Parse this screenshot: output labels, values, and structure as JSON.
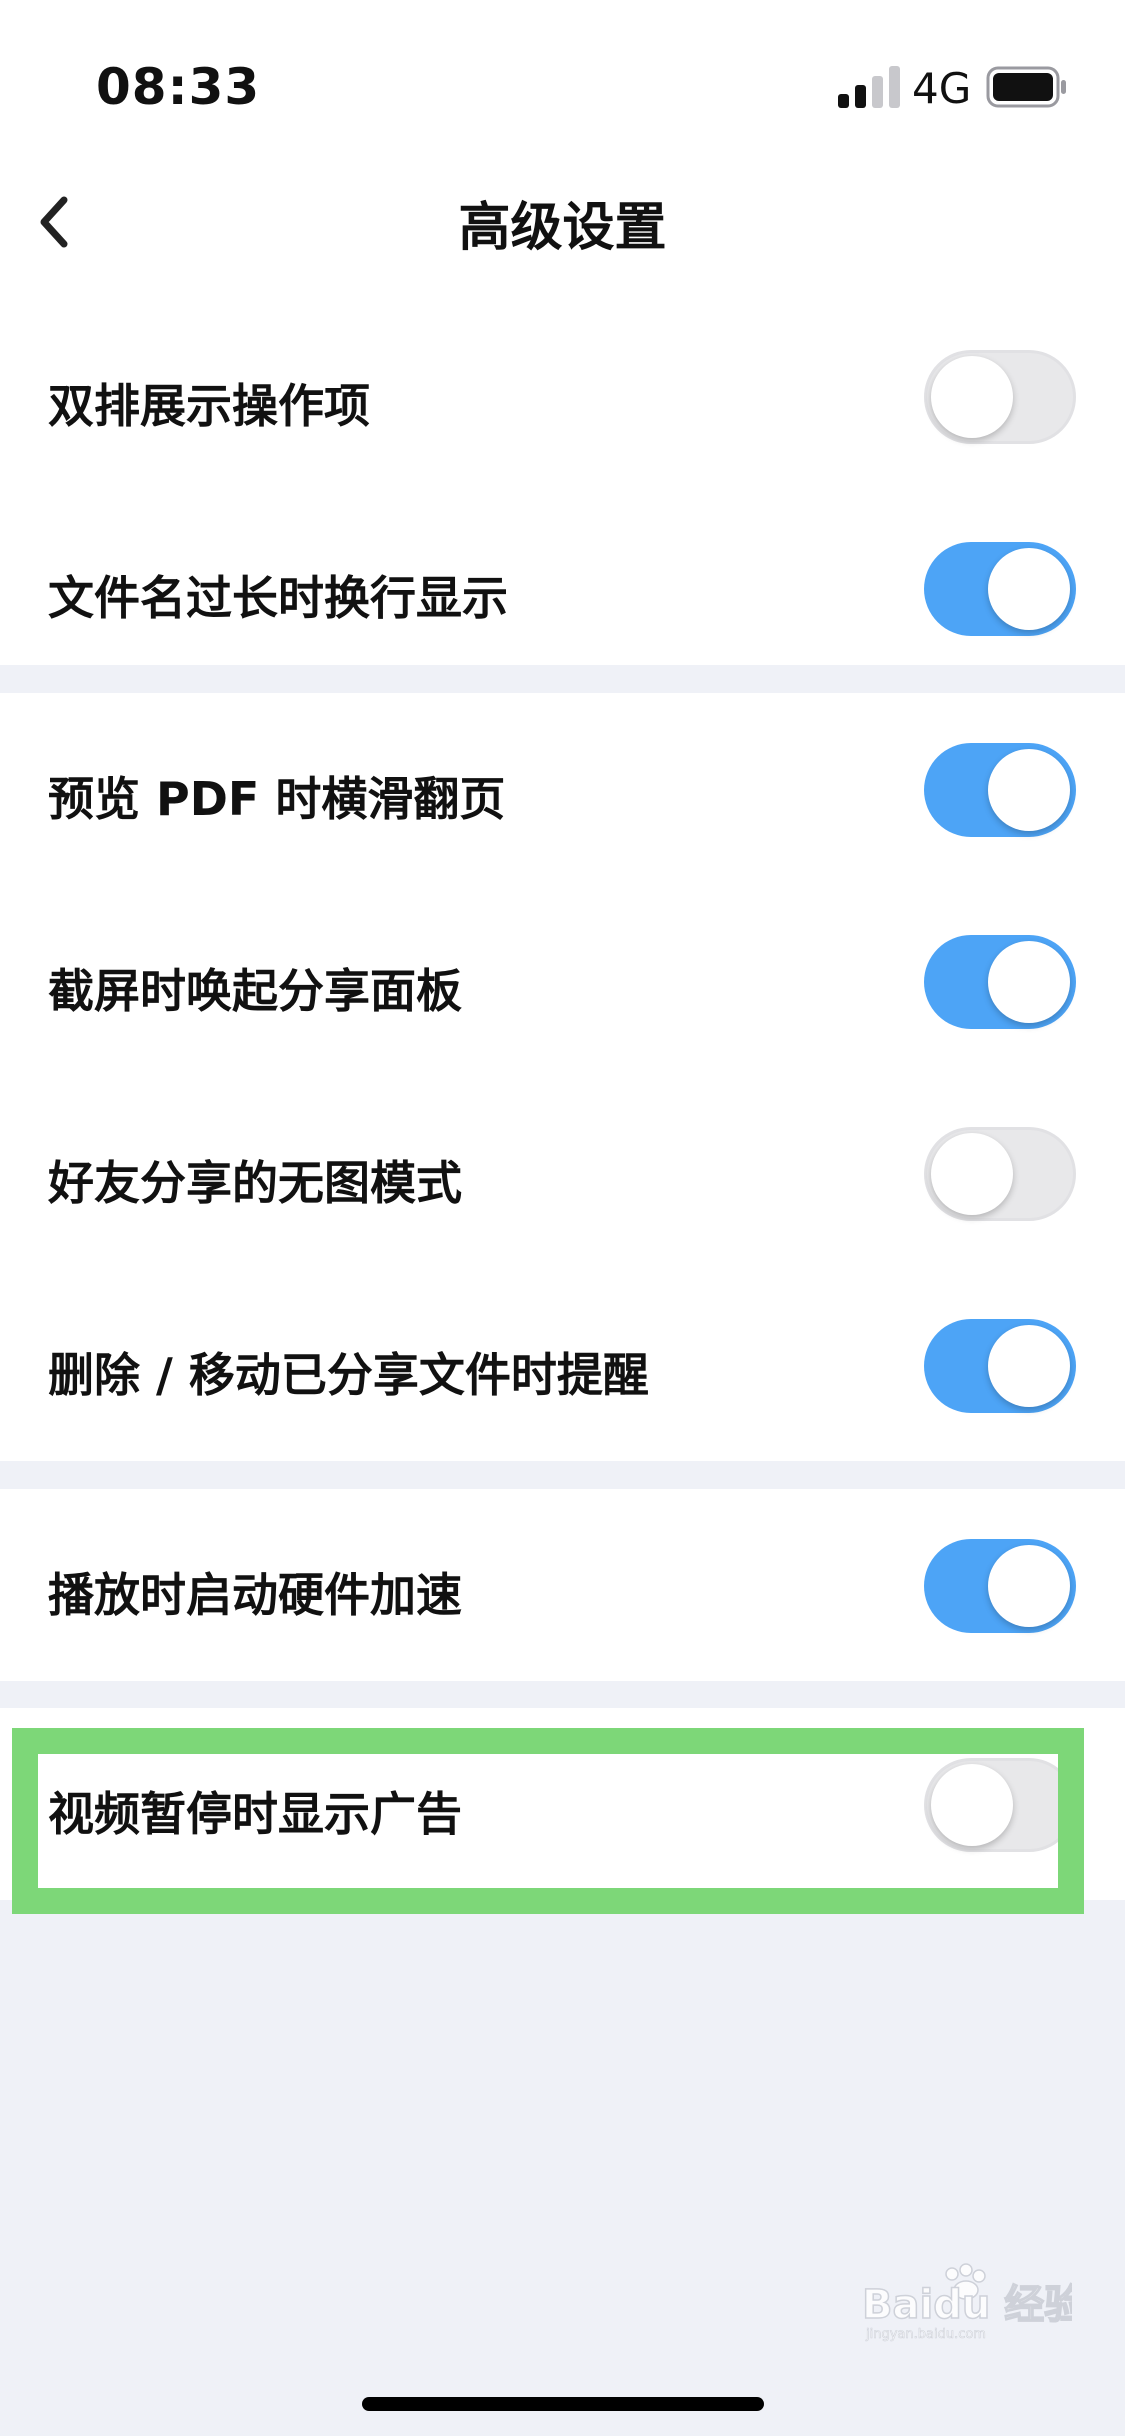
{
  "status_bar": {
    "time": "08:33",
    "network": "4G",
    "signal_icon": "signal-bars-icon",
    "battery_icon": "battery-full-icon"
  },
  "nav": {
    "back_icon": "chevron-left-icon",
    "title": "高级设置"
  },
  "sections": [
    {
      "rows": [
        {
          "label": "双排展示操作项",
          "on": false
        },
        {
          "label": "文件名过长时换行显示",
          "on": true
        }
      ]
    },
    {
      "rows": [
        {
          "label": "预览 PDF 时横滑翻页",
          "on": true
        },
        {
          "label": "截屏时唤起分享面板",
          "on": true
        },
        {
          "label": "好友分享的无图模式",
          "on": false
        },
        {
          "label": "删除 / 移动已分享文件时提醒",
          "on": true
        }
      ]
    },
    {
      "rows": [
        {
          "label": "播放时启动硬件加速",
          "on": true
        }
      ]
    },
    {
      "rows": [
        {
          "label": "视频暂停时显示广告",
          "on": false
        }
      ]
    }
  ],
  "watermark": {
    "text": "Baidu 经验",
    "sub": "jingyan.baidu.com"
  },
  "colors": {
    "toggle_on": "#4da4f6",
    "toggle_off": "#e8e8ea",
    "highlight": "#7dd778",
    "background": "#eff1f7"
  }
}
